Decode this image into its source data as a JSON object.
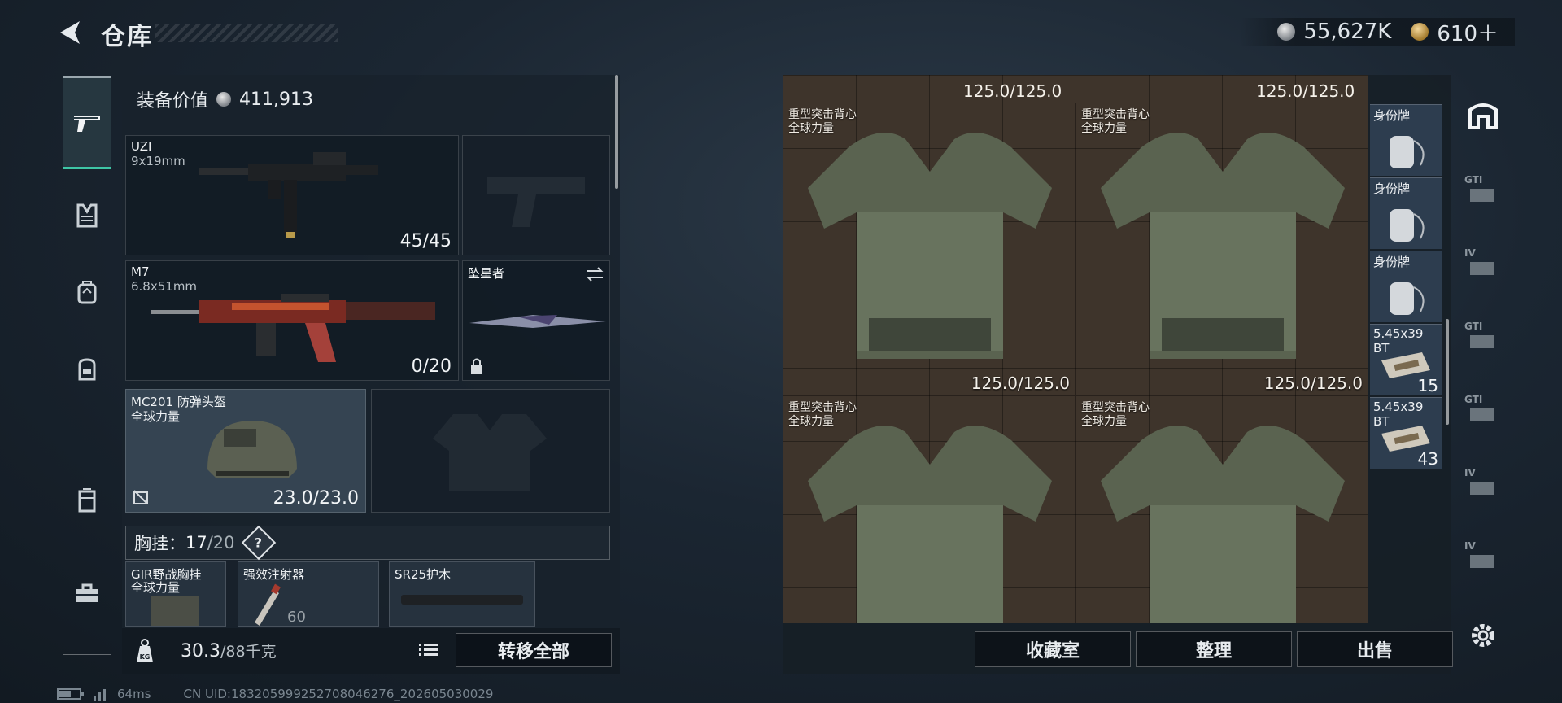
{
  "header": {
    "title": "仓库",
    "currency_silver": "55,627K",
    "currency_gold": "610＋"
  },
  "equipment": {
    "value_label": "装备价值",
    "value": "411,913",
    "primary": {
      "name": "UZI",
      "caliber": "9x19mm",
      "ammo": "45/45"
    },
    "secondary": {
      "name": "M7",
      "caliber": "6.8x51mm",
      "ammo": "0/20"
    },
    "melee": {
      "name": "坠星者"
    },
    "helmet": {
      "name": "MC201 防弹头盔",
      "sub": "全球力量",
      "durability": "23.0/23.0"
    },
    "rig_bar": {
      "label": "胸挂：",
      "current": "17",
      "max": "/20",
      "help": "?"
    },
    "rig_items": [
      {
        "name": "GIR野战胸挂",
        "sub": "全球力量"
      },
      {
        "name": "强效注射器",
        "extra": "60"
      },
      {
        "name": "SR25护木"
      }
    ]
  },
  "bottom_left": {
    "weight_icon_text": "KG",
    "weight_current": "30.3",
    "weight_max": "/88千克",
    "transfer_all": "转移全部"
  },
  "status": {
    "ping": "64ms",
    "uid": "CN UID:18320599925270804627​6_202605030029"
  },
  "stash": {
    "top_durabilities": [
      "125.0/125.0",
      "125.0/125.0"
    ],
    "vests": [
      {
        "name": "重型突击背心",
        "sub": "全球力量",
        "durability": "125.0/125.0"
      },
      {
        "name": "重型突击背心",
        "sub": "全球力量",
        "durability": "125.0/125.0"
      },
      {
        "name": "重型突击背心",
        "sub": "全球力量",
        "durability": ""
      },
      {
        "name": "重型突击背心",
        "sub": "全球力量",
        "durability": ""
      }
    ],
    "side_items": [
      {
        "name": "身份牌",
        "count": ""
      },
      {
        "name": "身份牌",
        "count": ""
      },
      {
        "name": "身份牌",
        "count": ""
      },
      {
        "name": "5.45x39 BT",
        "count": "15"
      },
      {
        "name": "5.45x39 BT",
        "count": "43"
      }
    ],
    "buttons": {
      "collection": "收藏室",
      "organize": "整理",
      "sell": "出售"
    }
  },
  "right_nav": [
    "GTI",
    "IV",
    "GTI",
    "GTI",
    "IV",
    "IV"
  ]
}
